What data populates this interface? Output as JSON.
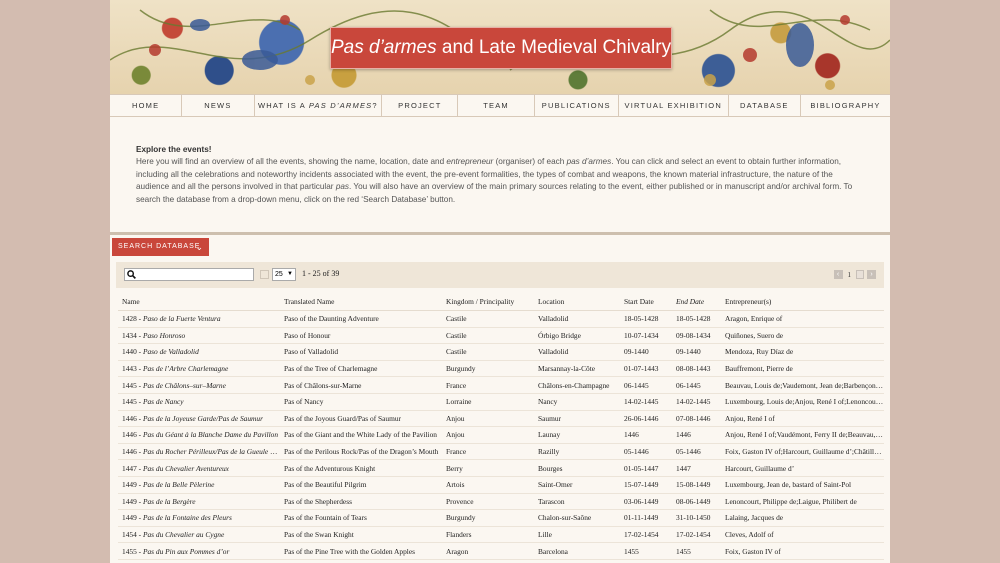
{
  "banner": {
    "title_italic": "Pas d’armes",
    "title_rest": " and Late Medieval Chivalry"
  },
  "nav": [
    {
      "label": "HOME"
    },
    {
      "label": "NEWS"
    },
    {
      "label": "WHAT IS A ",
      "italic": "PAS D’ARMES",
      "suffix": "?"
    },
    {
      "label": "PROJECT"
    },
    {
      "label": "TEAM"
    },
    {
      "label": "PUBLICATIONS"
    },
    {
      "label": "VIRTUAL EXHIBITION"
    },
    {
      "label": "DATABASE"
    },
    {
      "label": "BIBLIOGRAPHY"
    }
  ],
  "intro": {
    "heading": "Explore the events!",
    "p1": "Here you will find an overview of all the events, showing the name, location, date and ",
    "p1_italic": "entrepreneur",
    "p2": " (organiser) of each ",
    "p2_italic": "pas d’armes",
    "p3": ". You can click and select an event to obtain further information, including all the celebrations and noteworthy incidents associated with the event, the pre-event formalities, the types of combat and weapons, the known material infrastructure, the nature of the audience and all the persons involved in that particular ",
    "p3_italic": "pas",
    "p4": ". You will also have an overview of the main primary sources relating to the event, either published or in manuscript and/or archival form. To search the database from a drop-down menu, click on the red ‘Search Database’ button."
  },
  "search_db_label": "SEARCH DATABASE",
  "toolbar": {
    "search_value": "",
    "page_size": "25",
    "range": "1 - 25 of 39",
    "current_page": "1"
  },
  "table": {
    "headers": {
      "name": "Name",
      "translated": "Translated Name",
      "kingdom": "Kingdom / Principality",
      "location": "Location",
      "start": "Start Date",
      "end": "End Date",
      "entrepreneur": "Entrepreneur(s)"
    },
    "rows": [
      {
        "year": "1428 - ",
        "name": "Paso de la Fuerte Ventura",
        "translated": "Paso of the Daunting Adventure",
        "kingdom": "Castile",
        "location": "Valladolid",
        "start": "18-05-1428",
        "end": "18-05-1428",
        "entrepreneur": "Aragon, Enrique of"
      },
      {
        "year": "1434 - ",
        "name": "Paso Honroso",
        "translated": "Paso of Honour",
        "kingdom": "Castile",
        "location": "Órbigo Bridge",
        "start": "10-07-1434",
        "end": "09-08-1434",
        "entrepreneur": "Quiñones, Suero de"
      },
      {
        "year": "1440 - ",
        "name": "Paso de Valladolid",
        "translated": "Paso of Valladolid",
        "kingdom": "Castile",
        "location": "Valladolid",
        "start": "09-1440",
        "end": "09-1440",
        "entrepreneur": "Mendoza, Ruy Díaz de"
      },
      {
        "year": "1443 - ",
        "name": "Pas de l’Arbre Charlemagne",
        "translated": "Pas of the Tree of Charlemagne",
        "kingdom": "Burgundy",
        "location": "Marsannay-la-Côte",
        "start": "01-07-1443",
        "end": "08-08-1443",
        "entrepreneur": "Bauffremont, Pierre de"
      },
      {
        "year": "1445 - ",
        "name": "Pas de Châlons–sur–Marne",
        "translated": "Pas of Châlons-sur-Marne",
        "kingdom": "France",
        "location": "Châlons-en-Champagne",
        "start": "06-1445",
        "end": "06-1445",
        "entrepreneur": "Beauvau, Louis de;Vaudemont, Jean de;Barbençon, Jean de"
      },
      {
        "year": "1445 - ",
        "name": "Pas de Nancy",
        "translated": "Pas of Nancy",
        "kingdom": "Lorraine",
        "location": "Nancy",
        "start": "14-02-1445",
        "end": "14-02-1445",
        "entrepreneur": "Luxembourg, Louis de;Anjou, René I of;Lenoncourt, Philippe de"
      },
      {
        "year": "1446 - ",
        "name": "Pas de la Joyeuse Garde/Pas de Saumur",
        "translated": "Pas of the Joyous Guard/Pas of Saumur",
        "kingdom": "Anjou",
        "location": "Saumur",
        "start": "26-06-1446",
        "end": "07-08-1446",
        "entrepreneur": "Anjou, René I of"
      },
      {
        "year": "1446 - ",
        "name": "Pas du Géant à la Blanche Dame du Pavillon",
        "translated": "Pas of the Giant and the White Lady of the Pavilion",
        "kingdom": "Anjou",
        "location": "Launay",
        "start": "1446",
        "end": "1446",
        "entrepreneur": "Anjou, René I of;Vaudémont, Ferry II de;Beauvau, Louis de"
      },
      {
        "year": "1446 - ",
        "name": "Pas du Rocher Périlleux/Pas de la Gueule du Dragon",
        "translated": "Pas of the Perilous Rock/Pas of the Dragon’s Mouth",
        "kingdom": "France",
        "location": "Razilly",
        "start": "05-1446",
        "end": "05-1446",
        "entrepreneur": "Foix, Gaston IV of;Harcourt, Guillaume d’;Châtillon, Jean de"
      },
      {
        "year": "1447 - ",
        "name": "Pas du Chevalier Aventureux",
        "translated": "Pas of the Adventurous Knight",
        "kingdom": "Berry",
        "location": "Bourges",
        "start": "01-05-1447",
        "end": "1447",
        "entrepreneur": "Harcourt, Guillaume d’"
      },
      {
        "year": "1449 - ",
        "name": "Pas de la Belle Pèlerine",
        "translated": "Pas of the Beautiful Pilgrim",
        "kingdom": "Artois",
        "location": "Saint-Omer",
        "start": "15-07-1449",
        "end": "15-08-1449",
        "entrepreneur": "Luxembourg, Jean de, bastard of Saint-Pol"
      },
      {
        "year": "1449 - ",
        "name": "Pas de la Bergère",
        "translated": "Pas of the Shepherdess",
        "kingdom": "Provence",
        "location": "Tarascon",
        "start": "03-06-1449",
        "end": "08-06-1449",
        "entrepreneur": "Lenoncourt, Philippe de;Laigue, Philibert de"
      },
      {
        "year": "1449 - ",
        "name": "Pas de la Fontaine des Pleurs",
        "translated": "Pas of the Fountain of Tears",
        "kingdom": "Burgundy",
        "location": "Chalon-sur-Saône",
        "start": "01-11-1449",
        "end": "31-10-1450",
        "entrepreneur": "Lalaing, Jacques de"
      },
      {
        "year": "1454 - ",
        "name": "Pas du Chevalier au Cygne",
        "translated": "Pas of the Swan Knight",
        "kingdom": "Flanders",
        "location": "Lille",
        "start": "17-02-1454",
        "end": "17-02-1454",
        "entrepreneur": "Cleves, Adolf of"
      },
      {
        "year": "1455 - ",
        "name": "Pas du Pin aux Pommes d’or",
        "translated": "Pas of the Pine Tree with the Golden Apples",
        "kingdom": "Aragon",
        "location": "Barcelona",
        "start": "1455",
        "end": "1455",
        "entrepreneur": "Foix, Gaston IV of"
      }
    ]
  }
}
